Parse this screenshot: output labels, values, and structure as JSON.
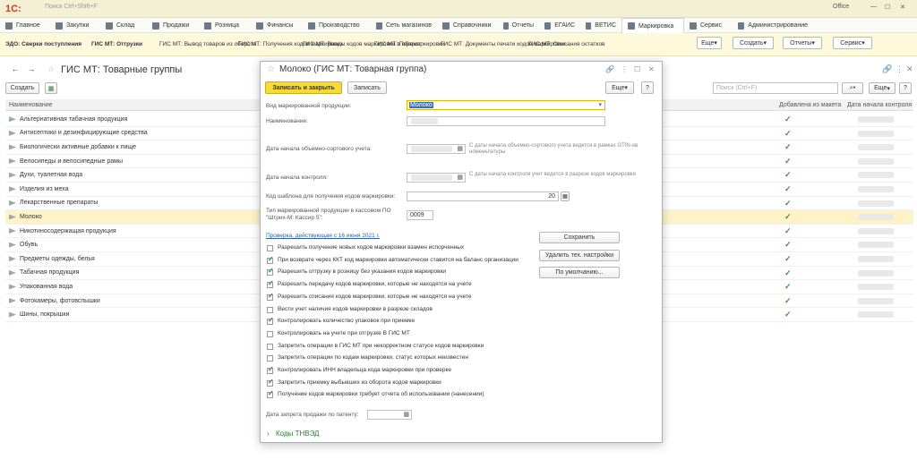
{
  "app": {
    "logo": "1С:",
    "search_hint": "Поиск Ctrl+Shift+F",
    "user": "Office"
  },
  "sections": [
    {
      "label": "Главное"
    },
    {
      "label": "Закупки"
    },
    {
      "label": "Склад"
    },
    {
      "label": "Продажи"
    },
    {
      "label": "Розница"
    },
    {
      "label": "Финансы"
    },
    {
      "label": "Производство"
    },
    {
      "label": "Сеть магазинов"
    },
    {
      "label": "Справочники"
    },
    {
      "label": "Отчеты"
    },
    {
      "label": "ЕГАИС"
    },
    {
      "label": "ВЕТИС"
    },
    {
      "label": "Маркировка"
    },
    {
      "label": "Сервис"
    },
    {
      "label": "Администрирование"
    }
  ],
  "commands": [
    "ЭДО: Сверки поступления",
    "ГИС МТ: Отгрузки",
    "ГИС МТ: Вывод товаров из оборота",
    "ГИС МТ: Получения кодов маркировки",
    "ГИС МТ: Вводы кодов маркировки в оборот",
    "ГИС МТ: Перемаркировки",
    "ГИС МТ: Документы печати кодов маркировки",
    "ГИС МТ: Описания остатков"
  ],
  "command_buttons": {
    "more": "Еще",
    "create": "Создать",
    "reports": "Отчеты",
    "service": "Сервис"
  },
  "list": {
    "title": "ГИС МТ: Товарные группы",
    "create_btn": "Создать",
    "search_placeholder": "Поиск (Ctrl+F)",
    "more_btn": "Еще",
    "help": "?",
    "columns": {
      "name": "Наименование",
      "added": "Добавлена из макета",
      "start": "Дата начала контроля"
    },
    "rows": [
      "Альтернативная табачная продукция",
      "Антисептики и дезинфицирующие средства",
      "Биологически активные добавки к пище",
      "Велосипеды и велосипедные рамы",
      "Духи, туалетная вода",
      "Изделия из меха",
      "Лекарственные препараты",
      "Молоко",
      "Никотиносодержащая продукция",
      "Обувь",
      "Предметы одежды, белья",
      "Табачная продукция",
      "Упакованная вода",
      "Фотокамеры, фотовспышки",
      "Шины, покрышки"
    ],
    "selected_index": 7
  },
  "dialog": {
    "title": "Молоко (ГИС МТ: Товарная группа)",
    "save_close": "Записать и закрыть",
    "save": "Записать",
    "more": "Еще",
    "help": "?",
    "labels": {
      "kind": "Вид маркированной продукции:",
      "name": "Наименование:",
      "start_volume": "Дата начала объемно-сортового учета:",
      "start_control": "Дата начала контроля:",
      "template": "Код шаблона для получения кодов маркировки:",
      "type_kassa": "Тип маркированной продукции в кассовом ПО \"Штрих-М: Кассир 5\":",
      "date_ban": "Дата запрета продажи по патенту:"
    },
    "kind_value": "Молоко",
    "template_value": "20",
    "kassa_value": "0009",
    "hint_volume": "С даты начала объемно-сортового учета ведется в рамках GTIN-ов номенклатуры",
    "hint_control": "С даты начала контроля учет ведется в разрезе кодов маркировки",
    "check_link": "Проверка, действующая с 16 июня 2021 г.",
    "btn_save": "Сохранить",
    "btn_delete": "Удалить тех. настройки",
    "btn_default": "По умолчанию...",
    "options": [
      {
        "label": "Разрешить получение новых кодов маркировки взамен испорченных",
        "on": false
      },
      {
        "label": "При возврате через ККТ код маркировки автоматически ставится на баланс организации",
        "on": true
      },
      {
        "label": "Разрешить отгрузку в розницу без указания кодов маркировки",
        "on": true
      },
      {
        "label": "Разрешить передачу кодов маркировки, которые не находятся на учете",
        "on": true
      },
      {
        "label": "Разрешить списания кодов маркировки, которые не находятся на учете",
        "on": true
      },
      {
        "label": "Вести учет наличия кодов маркировки в разрезе складов",
        "on": false
      },
      {
        "label": "Контролировать количество упаковок при приемке",
        "on": true
      },
      {
        "label": "Контролировать на учете при отгрузке В ГИС МТ",
        "on": false
      },
      {
        "label": "Запретить операции в ГИС МТ при некорректном статусе кодов маркировки",
        "on": false
      },
      {
        "label": "Запретить операции по кодам маркировки, статус которых неизвестен",
        "on": false
      },
      {
        "label": "Контролировать ИНН владельца кода маркировки при проверке",
        "on": true
      },
      {
        "label": "Запретить приемку выбывших из оборота кодов маркировки",
        "on": true
      },
      {
        "label": "Получение кодов маркировки требует отчета об использовании (нанесении)",
        "on": true
      }
    ],
    "tnved": "Коды ТНВЭД"
  },
  "colors": {
    "accent_yellow": "#f5da3a",
    "check_green": "#2e9c3f",
    "selected_row": "#fff3c6"
  }
}
